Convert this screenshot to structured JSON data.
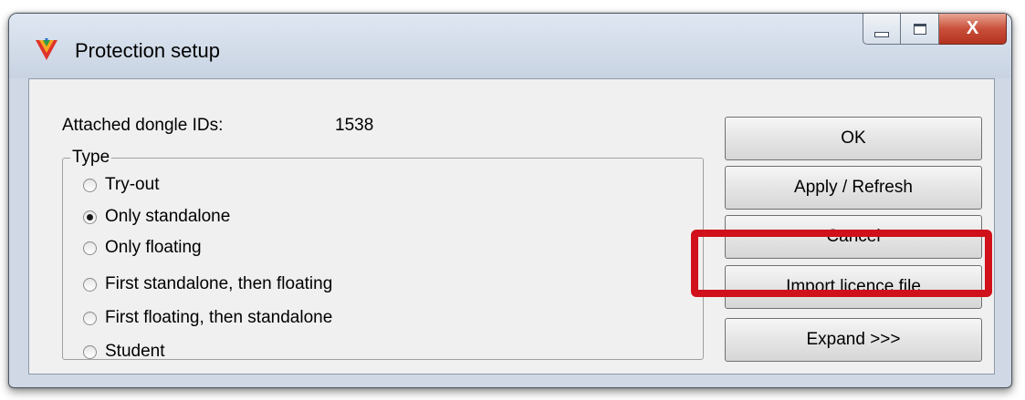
{
  "window": {
    "title": "Protection setup",
    "icons": {
      "app": "app-logo-icon",
      "minimize": "minimize-icon",
      "maximize": "maximize-icon",
      "close": "close-icon"
    },
    "close_glyph": "X"
  },
  "dongle": {
    "label": "Attached dongle IDs:",
    "value": "1538"
  },
  "type_group": {
    "legend": "Type",
    "options": [
      {
        "label": "Try-out",
        "checked": false
      },
      {
        "label": "Only standalone",
        "checked": true
      },
      {
        "label": "Only floating",
        "checked": false
      },
      {
        "label": "First standalone, then floating",
        "checked": false
      },
      {
        "label": "First floating, then standalone",
        "checked": false
      },
      {
        "label": "Student",
        "checked": false
      }
    ]
  },
  "buttons": {
    "ok": "OK",
    "apply": "Apply / Refresh",
    "cancel": "Cancel",
    "import": "Import licence file",
    "expand": "Expand >>>"
  },
  "colors": {
    "highlight": "#d0101b",
    "close_button": "#c9503b"
  }
}
